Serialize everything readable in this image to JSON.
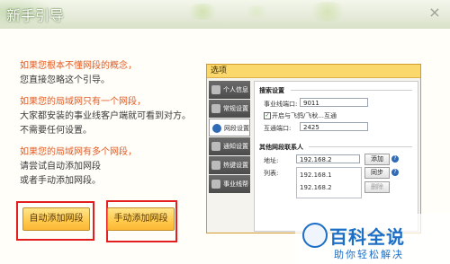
{
  "window": {
    "title": "新手引导",
    "close_glyph": "×"
  },
  "intro": {
    "line1_red": "如果您根本不懂网段的概念，",
    "line2": "您直接忽略这个引导。",
    "line3_red": "如果您的局域网只有一个网段，",
    "line4": "大家都安装的事业线客户端就可看到对方。",
    "line5": "不需要任何设置。",
    "line6_red": "如果您的局域网有多个网段，",
    "line7": "请尝试自动添加网段",
    "line8": "或者手动添加网段。"
  },
  "buttons": {
    "auto_add": "自动添加网段",
    "manual_add": "手动添加网段"
  },
  "dialog": {
    "title": "选项",
    "nav": [
      {
        "label": "个人信息"
      },
      {
        "label": "常规设置"
      },
      {
        "label": "网段设置"
      },
      {
        "label": "通知设置"
      },
      {
        "label": "热键设置"
      },
      {
        "label": "事业线帮"
      }
    ],
    "search_section": "搜索设置",
    "port_label": "事业线端口:",
    "port_value": "9011",
    "checkbox_label": "开启与飞鸽/飞秋...互通",
    "checkbox_checked": "✓",
    "interop_port_label": "互通端口:",
    "interop_port_value": "2425",
    "other_section": "其他网段联系人",
    "address_label": "地址:",
    "address_value": "192.168.2",
    "list_label": "列表:",
    "list_items": [
      "192.168.1",
      "192.168.2"
    ],
    "add_button": "添加",
    "sync_button": "同步",
    "delete_button": "删除",
    "help_glyph": "?"
  },
  "watermark": {
    "main": "百科全说",
    "sub": "助你轻松解决"
  }
}
